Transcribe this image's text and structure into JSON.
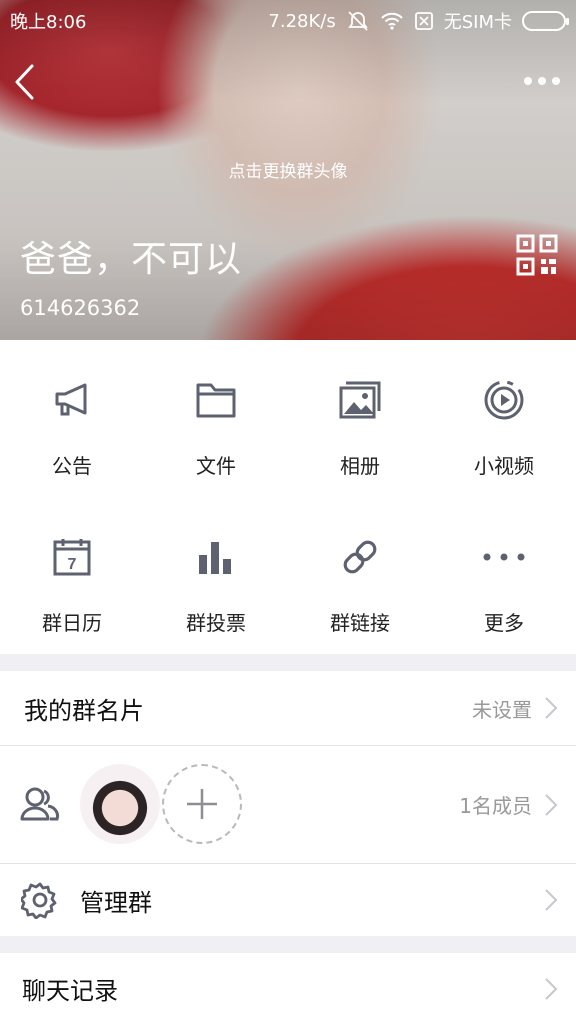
{
  "status_bar": {
    "time": "晚上8:06",
    "network_speed": "7.28K/s",
    "sim_status": "无SIM卡",
    "icons": [
      "mute-icon",
      "wifi-icon",
      "sim-icon",
      "battery-icon"
    ]
  },
  "header": {
    "change_avatar_hint": "点击更换群头像",
    "group_name": "爸爸，不可以",
    "group_id": "614626362"
  },
  "features": [
    {
      "label": "公告",
      "icon": "megaphone-icon"
    },
    {
      "label": "文件",
      "icon": "folder-icon"
    },
    {
      "label": "相册",
      "icon": "photo-album-icon"
    },
    {
      "label": "小视频",
      "icon": "video-play-icon"
    },
    {
      "label": "群日历",
      "icon": "calendar-icon"
    },
    {
      "label": "群投票",
      "icon": "bar-chart-icon"
    },
    {
      "label": "群链接",
      "icon": "link-icon"
    },
    {
      "label": "更多",
      "icon": "more-dots-icon"
    }
  ],
  "calendar_day": "7",
  "rows": {
    "my_card": {
      "title": "我的群名片",
      "value": "未设置"
    },
    "members": {
      "value": "1名成员"
    },
    "manage": {
      "title": "管理群"
    },
    "chat_history": {
      "title": "聊天记录"
    }
  },
  "colors": {
    "icon_gray": "#5e6270",
    "chevron_gray": "#c7c7cc",
    "separator_bg": "#efeff4"
  }
}
